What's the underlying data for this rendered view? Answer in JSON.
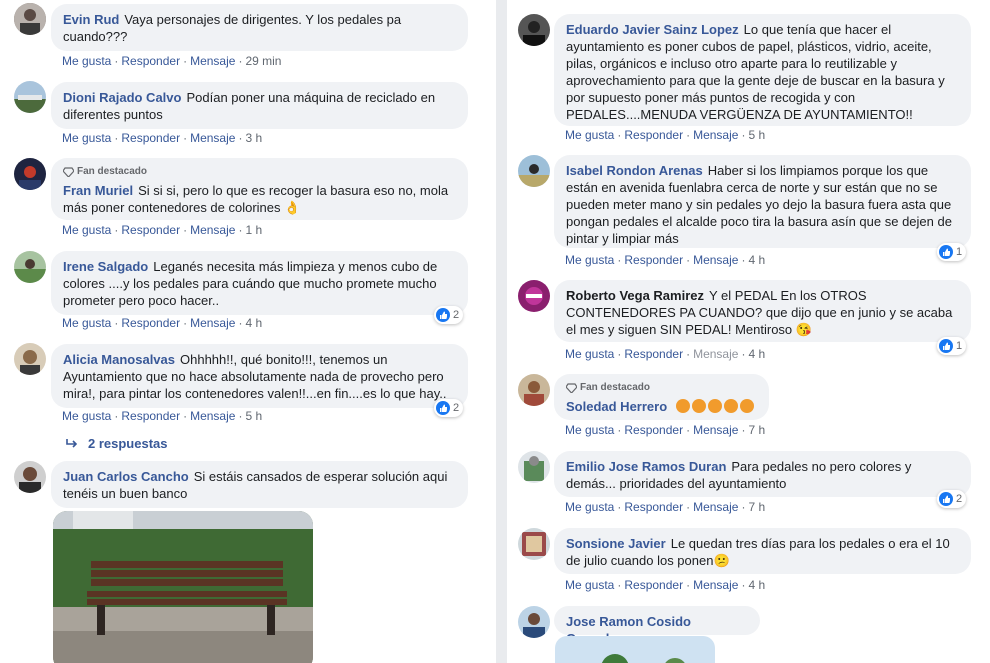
{
  "left": {
    "comments": [
      {
        "author": "Evin Rud",
        "text": "Vaya personajes de dirigentes. Y los pedales pa cuandо???",
        "like": "Me gusta",
        "reply": "Responder",
        "message": "Mensaje",
        "time": "29 min"
      },
      {
        "author": "Dioni Rajado Calvo",
        "text": "Podían poner una máquina de reciclado en diferentes puntos",
        "like": "Me gusta",
        "reply": "Responder",
        "message": "Mensaje",
        "time": "3 h"
      },
      {
        "badge": "Fan destacado",
        "author": "Fran Muriel",
        "text": "Si si si, pero lo que es recoger la basura eso no, mola más poner contenedores de colorines 👌",
        "like": "Me gusta",
        "reply": "Responder",
        "message": "Mensaje",
        "time": "1 h"
      },
      {
        "author": "Irene Salgado",
        "text": "Leganés necesita más limpieza y menos cubo de colores ....y los pedales para cuándo que mucho promete mucho prometer pero poco hacer..",
        "like": "Me gusta",
        "reply": "Responder",
        "message": "Mensaje",
        "time": "4 h",
        "reactions": "2"
      },
      {
        "author": "Alicia Manosalvas",
        "text": "Ohhhhh!!, qué bonito!!!, tenemos un Ayuntamiento que no hace absolutamente nada de provecho pero mira!, para pintar los contenedores valen!!...en fin....es lo que hay..",
        "like": "Me gusta",
        "reply": "Responder",
        "message": "Mensaje",
        "time": "5 h",
        "reactions": "2"
      },
      {
        "author": "Juan Carlos Cancho",
        "text": "Si estáis cansados de esperar solución aqui tenéis un buen banco"
      }
    ],
    "replies_label": "2 respuestas"
  },
  "right": {
    "comments": [
      {
        "author": "Eduardo Javier Sainz Lopez",
        "text": "Lo que tenía que hacer el ayuntamiento es poner cubos de papel, plásticos, vidrio, aceite, pilas, orgánicos e incluso otro aparte para lo reutilizable y aprovechamiento para que la gente deje de buscar en la basura y por supuesto poner más puntos de recogida y con PEDALES....MENUDA VERGÜENZA DE AYUNTAMIENTO!!",
        "like": "Me gusta",
        "reply": "Responder",
        "message": "Mensaje",
        "time": "5 h"
      },
      {
        "author": "Isabel Rondon Arenas",
        "text": "Haber si los limpiamos porque los que están en avenida fuenlabra cerca de norte y sur están que no se pueden meter mano y sin pedales yo dejo la basura fuera asta que pongan pedales el alcalde poco tira la basura asín que se dejen de pintar y limpiar más",
        "like": "Me gusta",
        "reply": "Responder",
        "message": "Mensaje",
        "time": "4 h",
        "reactions": "1"
      },
      {
        "author": "Roberto Vega Ramirez",
        "text": "Y el PEDAL En los OTROS CONTENEDORES PA CUANDO? que dijo que en junio y se acaba el mes y siguen SIN PEDAL! Mentiroso 😘",
        "like": "Me gusta",
        "reply": "Responder",
        "message": "Mensaje",
        "time": "4 h",
        "reactions": "1"
      },
      {
        "badge": "Fan destacado",
        "author": "Soledad Herrero",
        "text": "",
        "like": "Me gusta",
        "reply": "Responder",
        "message": "Mensaje",
        "time": "7 h"
      },
      {
        "author": "Emilio Jose Ramos Duran",
        "text": "Para pedales no pero colores y demás... prioridades del ayuntamiento",
        "like": "Me gusta",
        "reply": "Responder",
        "message": "Mensaje",
        "time": "7 h",
        "reactions": "2"
      },
      {
        "author": "Sonsione Javier",
        "text": "Le quedan tres días para los pedales o era el 10 de julio cuando los ponen😕",
        "like": "Me gusta",
        "reply": "Responder",
        "message": "Mensaje",
        "time": "4 h"
      },
      {
        "author": "Jose Ramon Cosido Gonzalez",
        "text": ""
      }
    ]
  },
  "colors": {
    "link": "#385898",
    "bubble": "#f0f2f5",
    "like": "#1877f2",
    "background": "#e9ebee"
  }
}
